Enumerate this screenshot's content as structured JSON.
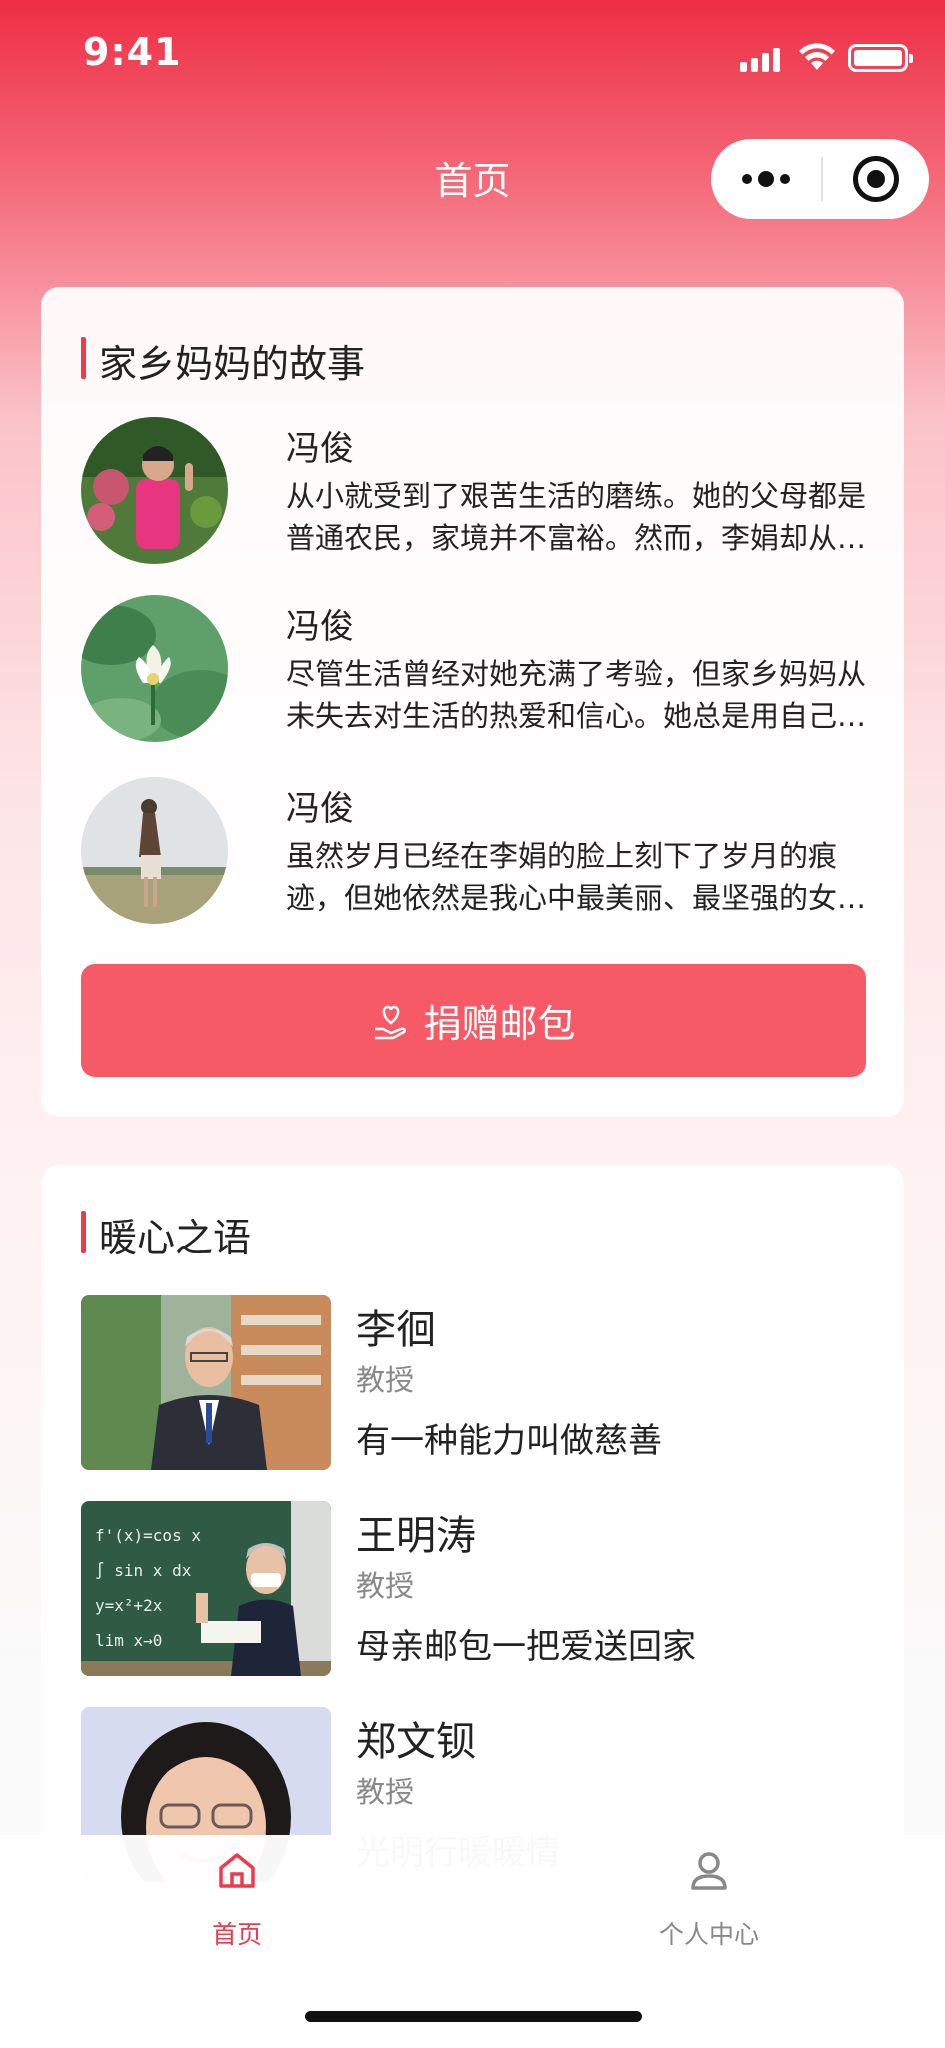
{
  "status_bar": {
    "time": "9:41"
  },
  "nav": {
    "title": "首页"
  },
  "stories": {
    "section_title": "家乡妈妈的故事",
    "items": [
      {
        "name": "冯俊",
        "text": "从小就受到了艰苦生活的磨练。她的父母都是普通农民，家境并不富裕。然而，李娟却从…"
      },
      {
        "name": "冯俊",
        "text": "尽管生活曾经对她充满了考验，但家乡妈妈从未失去对生活的热爱和信心。她总是用自己…"
      },
      {
        "name": "冯俊",
        "text": "虽然岁月已经在李娟的脸上刻下了岁月的痕迹，但她依然是我心中最美丽、最坚强的女…"
      }
    ],
    "donate_label": "捐赠邮包"
  },
  "warm_words": {
    "section_title": "暖心之语",
    "items": [
      {
        "name": "李徊",
        "title": "教授",
        "quote": "有一种能力叫做慈善"
      },
      {
        "name": "王明涛",
        "title": "教授",
        "quote": "母亲邮包一把爱送回家"
      },
      {
        "name": "郑文钡",
        "title": "教授",
        "quote": "光明行暖暖情"
      }
    ]
  },
  "tabbar": {
    "tabs": [
      {
        "label": "首页",
        "icon": "home-icon",
        "active": true
      },
      {
        "label": "个人中心",
        "icon": "user-icon",
        "active": false
      }
    ]
  },
  "colors": {
    "accent": "#ee3a4c",
    "button": "#f65a66",
    "tab_active": "#ee3a4c",
    "tab_inactive": "#888888"
  }
}
